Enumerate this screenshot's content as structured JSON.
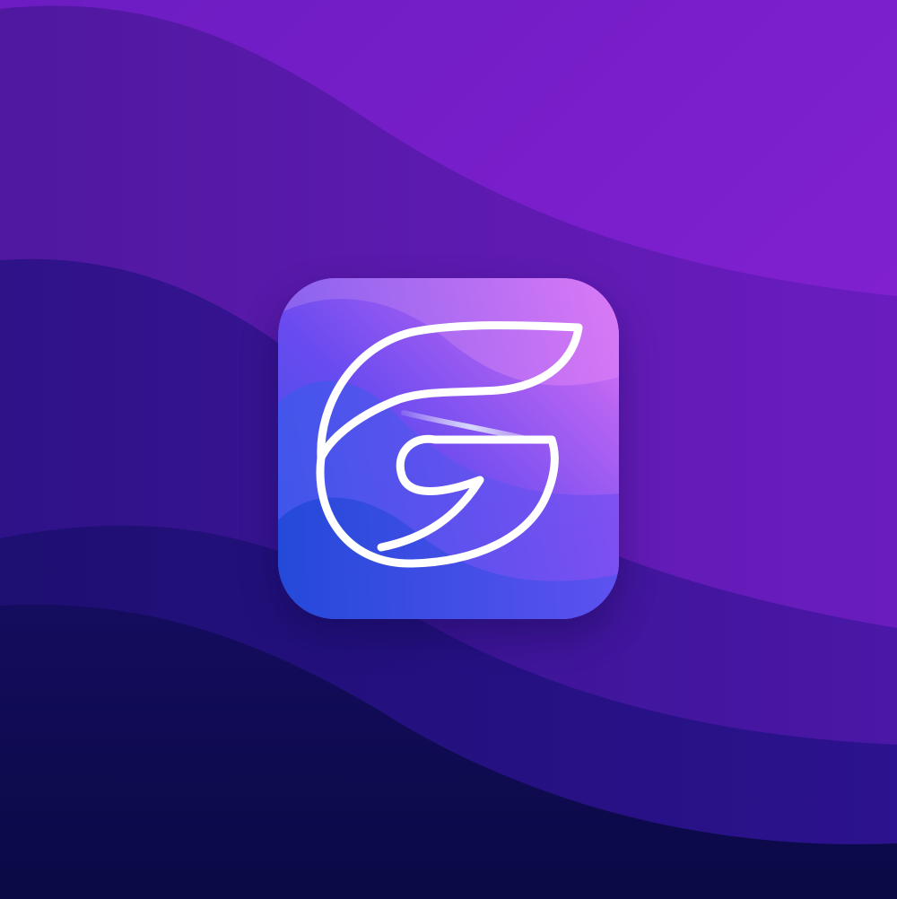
{
  "scene": {
    "description_free": true,
    "background_colors": {
      "top_band": "#7d1fcf",
      "upper_band": "#5d1aae",
      "middle_band": "#3b1496",
      "lower_band": "#22107a",
      "bottom_band": "#100c56"
    }
  },
  "app_icon": {
    "icon_name": "letter-g-logo-icon",
    "gradient_colors": {
      "top_right": "#e57cf6",
      "top_left": "#9b6cf0",
      "mid": "#6a4df0",
      "bottom_left": "#2f4fe0"
    },
    "stroke_color": "#ffffff"
  }
}
